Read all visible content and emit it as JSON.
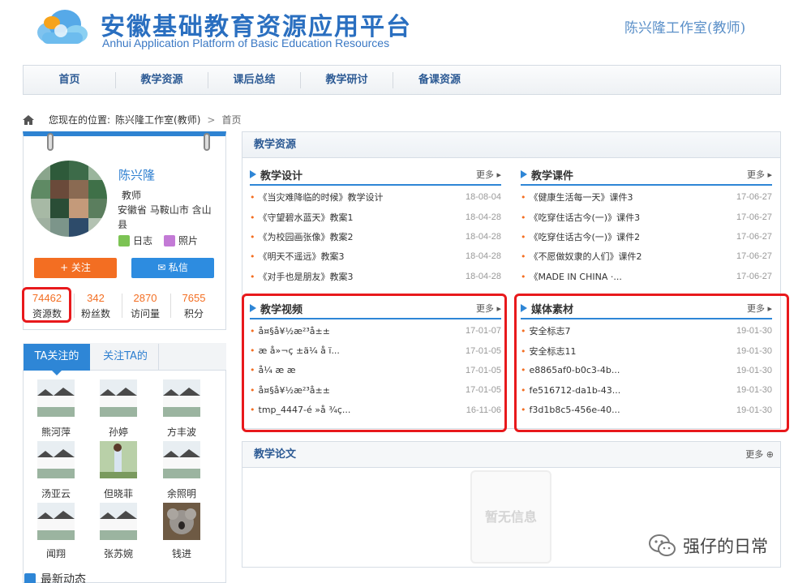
{
  "header": {
    "title": "安徽基础教育资源应用平台",
    "subtitle": "Anhui Application Platform of Basic Education Resources",
    "studio": "陈兴隆工作室(教师)"
  },
  "nav": [
    "首页",
    "教学资源",
    "课后总结",
    "教学研讨",
    "备课资源"
  ],
  "breadcrumb": {
    "prefix": "您现在的位置:",
    "studio": "陈兴隆工作室(教师)",
    "sep": ">",
    "current": "首页"
  },
  "profile": {
    "name": "陈兴隆",
    "role": "教师",
    "location": "安徽省 马鞍山市 含山县",
    "diary": "日志",
    "photos": "照片",
    "follow": "+ 关注",
    "message": "✉ 私信",
    "stats": [
      {
        "value": "74462",
        "label": "资源数"
      },
      {
        "value": "342",
        "label": "粉丝数"
      },
      {
        "value": "2870",
        "label": "访问量"
      },
      {
        "value": "7655",
        "label": "积分"
      }
    ]
  },
  "follows": {
    "tab_active": "TA关注的",
    "tab_other": "关注TA的",
    "people": [
      "熊河萍",
      "孙婷",
      "方丰波",
      "汤亚云",
      "但晓菲",
      "余照明",
      "闻翔",
      "张苏婉",
      "钱进"
    ]
  },
  "news_label": "最新动态",
  "resources": {
    "panel_title": "教学资源",
    "more": "更多",
    "sections": [
      {
        "title": "教学设计",
        "items": [
          {
            "t": "《当灾难降临的时候》教学设计",
            "d": "18-08-04"
          },
          {
            "t": "《守望碧水蓝天》教案1",
            "d": "18-04-28"
          },
          {
            "t": "《为校园画张像》教案2",
            "d": "18-04-28"
          },
          {
            "t": "《明天不遥远》教案3",
            "d": "18-04-28"
          },
          {
            "t": "《对手也是朋友》教案3",
            "d": "18-04-28"
          }
        ]
      },
      {
        "title": "教学课件",
        "items": [
          {
            "t": "《健康生活每一天》课件3",
            "d": "17-06-27"
          },
          {
            "t": "《吃穿住话古今(一)》课件3",
            "d": "17-06-27"
          },
          {
            "t": "《吃穿住话古今(一)》课件2",
            "d": "17-06-27"
          },
          {
            "t": "《不愿做奴隶的人们》课件2",
            "d": "17-06-27"
          },
          {
            "t": "《MADE IN CHINA ·...",
            "d": "17-06-27"
          }
        ]
      },
      {
        "title": "教学视频",
        "items": [
          {
            "t": "å¤§å¥½æ²³å±±",
            "d": "17-01-07"
          },
          {
            "t": "æ    å»¬ç  ±ä¼  å    ï...",
            "d": "17-01-05"
          },
          {
            "t": "å¼  æ   ­æ",
            "d": "17-01-05"
          },
          {
            "t": "å¤§å¥½æ²³å±±",
            "d": "17-01-05"
          },
          {
            "t": "tmp_4447-é  »å  ¾ç...",
            "d": "16-11-06"
          }
        ]
      },
      {
        "title": "媒体素材",
        "items": [
          {
            "t": "安全标志7",
            "d": "19-01-30"
          },
          {
            "t": "安全标志11",
            "d": "19-01-30"
          },
          {
            "t": "e8865af0-b0c3-4b...",
            "d": "19-01-30"
          },
          {
            "t": "fe516712-da1b-43...",
            "d": "19-01-30"
          },
          {
            "t": "f3d1b8c5-456e-40...",
            "d": "19-01-30"
          }
        ]
      }
    ]
  },
  "papers": {
    "title": "教学论文",
    "more": "更多",
    "empty": "暂无信息"
  },
  "watermark": "强仔的日常",
  "colors": {
    "accent": "#2e86d6",
    "orange": "#f36e22",
    "highlight": "#e8191c"
  }
}
